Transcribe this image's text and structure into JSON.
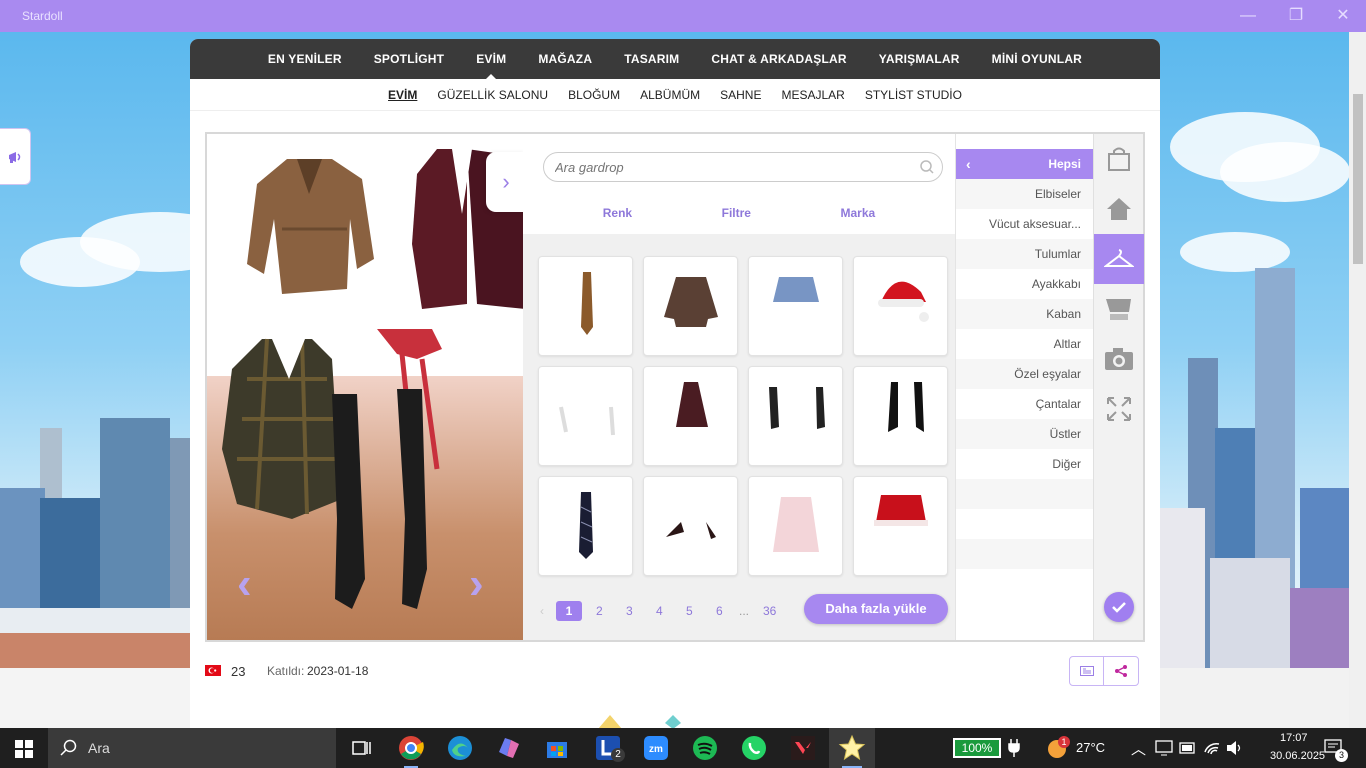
{
  "window": {
    "title": "Stardoll"
  },
  "main_nav": [
    {
      "label": "EN YENİLER"
    },
    {
      "label": "SPOTLİGHT"
    },
    {
      "label": "EVİM",
      "active": true
    },
    {
      "label": "MAĞAZA"
    },
    {
      "label": "TASARIM"
    },
    {
      "label": "CHAT & ARKADAŞLAR"
    },
    {
      "label": "YARIŞMALAR"
    },
    {
      "label": "MİNİ OYUNLAR"
    }
  ],
  "sub_nav": [
    {
      "label": "EVİM",
      "active": true
    },
    {
      "label": "GÜZELLİK SALONU"
    },
    {
      "label": "BLOĞUM"
    },
    {
      "label": "ALBÜMÜM"
    },
    {
      "label": "SAHNE"
    },
    {
      "label": "MESAJLAR"
    },
    {
      "label": "STYLİST STUDİO"
    }
  ],
  "wardrobe": {
    "search_placeholder": "Ara gardrop",
    "filters": {
      "color": "Renk",
      "filter": "Filtre",
      "brand": "Marka"
    },
    "items": [
      "tie-brown",
      "jacket-brown",
      "skirt-denim",
      "santa-hat",
      "earrings-silver",
      "skirt-burgundy",
      "gloves-black",
      "boots-black",
      "necktie-striped",
      "heels-black",
      "coat-pink-fur",
      "skirt-red-santa"
    ],
    "pagination": {
      "pages": [
        "1",
        "2",
        "3",
        "4",
        "5",
        "6"
      ],
      "ellipsis": "...",
      "last": "36",
      "current": "1"
    },
    "load_more": "Daha fazla yükle"
  },
  "categories": {
    "active": "Hepsi",
    "items": [
      "Elbiseler",
      "Vücut aksesuar...",
      "Tulumlar",
      "Ayakkabı",
      "Kaban",
      "Altlar",
      "Özel eşyalar",
      "Çantalar",
      "Üstler",
      "Diğer"
    ]
  },
  "tools": [
    "shopping-bag-icon",
    "home-icon",
    "hanger-icon",
    "cart-icon",
    "camera-icon",
    "fullscreen-icon"
  ],
  "profile": {
    "age": "23",
    "joined_label": "Katıldı:",
    "joined_date": "2023-01-18",
    "country_flag": "turkey-flag-icon"
  },
  "taskbar": {
    "search_label": "Ara",
    "battery": "100%",
    "weather": "27°C",
    "weather_badge": "1",
    "lens_badge": "2",
    "time": "17:07",
    "date": "30.06.2025",
    "notifications": "3"
  },
  "colors": {
    "accent": "#a788f0",
    "nav_bg": "#3a3a3a",
    "titlebar": "#a98af0"
  }
}
